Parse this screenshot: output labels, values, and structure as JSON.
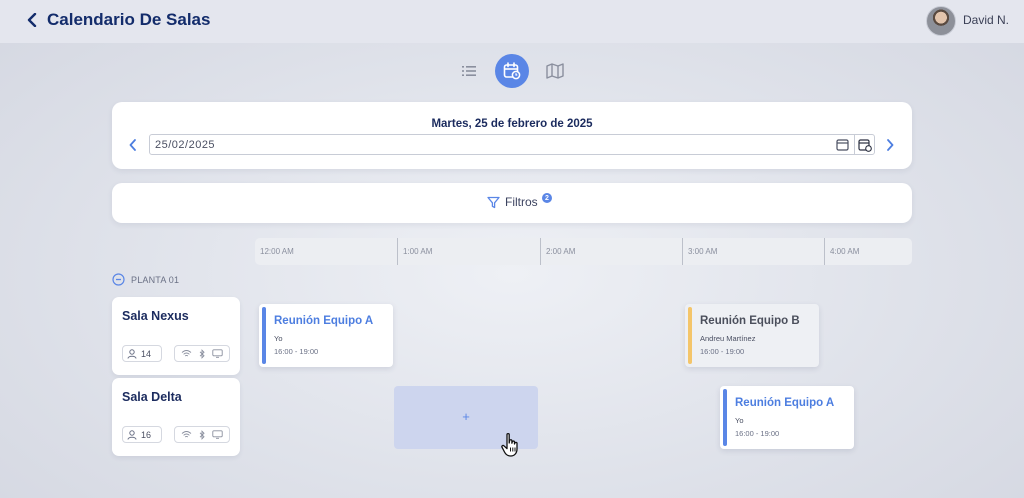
{
  "header": {
    "title": "Calendario De Salas",
    "user_name": "David N."
  },
  "view_switch": {
    "options": [
      "list-icon",
      "calendar-icon",
      "map-icon"
    ],
    "selected": "calendar"
  },
  "date_panel": {
    "heading": "Martes, 25 de febrero de 2025",
    "date_value": "25/02/2025"
  },
  "filters": {
    "label": "Filtros",
    "count": "2"
  },
  "timeline": {
    "ticks": [
      "12:00 AM",
      "1:00 AM",
      "2:00 AM",
      "3:00 AM",
      "4:00 AM"
    ]
  },
  "floor": {
    "label": "PLANTA 01"
  },
  "rooms": [
    {
      "name": "Sala Nexus",
      "capacity": "14"
    },
    {
      "name": "Sala Delta",
      "capacity": "16"
    }
  ],
  "events": [
    {
      "title": "Reunión Equipo A",
      "organizer": "Yo",
      "time": "16:00 - 19:00",
      "mine": true
    },
    {
      "title": "Reunión Equipo B",
      "organizer": "Andreu Martínez",
      "time": "16:00 - 19:00",
      "mine": false
    },
    {
      "title": "Reunión Equipo A",
      "organizer": "Yo",
      "time": "16:00 - 19:00",
      "mine": true
    }
  ],
  "new_slot": {
    "label": "+"
  },
  "colors": {
    "accent": "#5a86e6",
    "title": "#132c6b",
    "other_event_bar": "#f4c56a"
  }
}
